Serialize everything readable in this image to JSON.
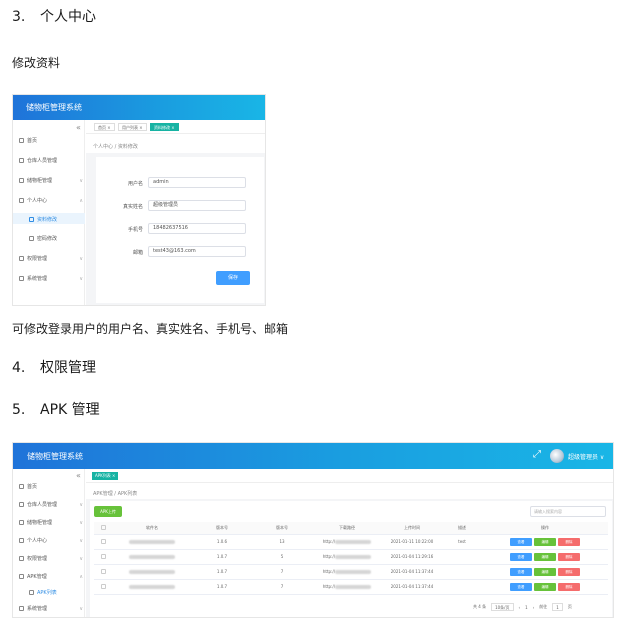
{
  "doc": {
    "section3": {
      "num": "3.",
      "title": "个人中心"
    },
    "subheading": "修改资料",
    "description": "可修改登录用户的用户名、真实姓名、手机号、邮箱",
    "section4": {
      "num": "4.",
      "title": "权限管理"
    },
    "section5": {
      "num": "5.",
      "title": "APK 管理"
    }
  },
  "shot1": {
    "app_title": "储物柜管理系统",
    "collapse_icon": "«",
    "nav": [
      {
        "label": "首页",
        "icon": "home-icon"
      },
      {
        "label": "仓库人员管理",
        "icon": "users-icon",
        "arrow": "∨"
      },
      {
        "label": "储物柜管理",
        "icon": "cabinet-icon",
        "arrow": "∨"
      },
      {
        "label": "个人中心",
        "icon": "user-icon",
        "arrow": "∧"
      },
      {
        "label": "资料修改",
        "icon": "doc-icon"
      },
      {
        "label": "密码修改",
        "icon": "key-icon"
      },
      {
        "label": "权限管理",
        "icon": "shield-icon",
        "arrow": "∨"
      },
      {
        "label": "系统管理",
        "icon": "gear-icon",
        "arrow": "∨"
      }
    ],
    "tabs": [
      {
        "label": "首页 ×"
      },
      {
        "label": "用户列表 ×"
      },
      {
        "label": "资料修改 ×"
      }
    ],
    "breadcrumb": "个人中心 / 资料修改",
    "form": {
      "username_label": "用户名",
      "username_value": "admin",
      "realname_label": "真实姓名",
      "realname_value": "超级管理员",
      "phone_label": "手机号",
      "phone_value": "18482637516",
      "email_label": "邮箱",
      "email_value": "test43@163.com",
      "save_label": "保存"
    }
  },
  "shot2": {
    "app_title": "储物柜管理系统",
    "fullscreen_icon": "⤢",
    "user_name": "超级管理员 ∨",
    "collapse_icon": "«",
    "nav": [
      {
        "label": "首页",
        "icon": "home-icon"
      },
      {
        "label": "仓库人员管理",
        "icon": "users-icon",
        "arrow": "∨"
      },
      {
        "label": "储物柜管理",
        "icon": "cabinet-icon",
        "arrow": "∨"
      },
      {
        "label": "个人中心",
        "icon": "user-icon",
        "arrow": "∨"
      },
      {
        "label": "权限管理",
        "icon": "shield-icon",
        "arrow": "∨"
      },
      {
        "label": "APK管理",
        "icon": "apk-icon",
        "arrow": "∧"
      },
      {
        "label": "APK列表",
        "icon": "list-icon"
      },
      {
        "label": "系统管理",
        "icon": "gear-icon",
        "arrow": "∨"
      }
    ],
    "tab_label": "APK列表 ×",
    "breadcrumb": "APK管理 / APK列表",
    "upload_label": "APK上传",
    "search_placeholder": "请输入搜索内容",
    "columns": [
      "",
      "软件名",
      "版本号",
      "版本号",
      "下载路径",
      "上传时间",
      "描述",
      "操作"
    ],
    "rows": [
      {
        "version": "1.0.6",
        "code": "13",
        "path": "http://",
        "time": "2021-01-11 10:22:00",
        "desc": "test"
      },
      {
        "version": "1.0.7",
        "code": "5",
        "path": "http://",
        "time": "2021-01-04 11:29:16",
        "desc": ""
      },
      {
        "version": "1.0.7",
        "code": "7",
        "path": "http://",
        "time": "2021-01-04 11:37:44",
        "desc": ""
      },
      {
        "version": "1.0.7",
        "code": "7",
        "path": "http://",
        "time": "2021-01-04 11:37:44",
        "desc": ""
      }
    ],
    "actions": {
      "view": "查看",
      "edit": "编辑",
      "delete": "删除"
    },
    "pager": {
      "total": "共 4 条",
      "size": "10条/页",
      "prev": "‹",
      "page": "1",
      "next": "›",
      "goto": "前往",
      "goto_page": "1",
      "goto_suffix": "页"
    }
  },
  "colors": {
    "header_start": "#1f73d9",
    "header_end": "#19b6e6",
    "primary": "#409eff",
    "success": "#67c23a",
    "danger": "#f56c6c",
    "tab_active": "#17b3a3"
  }
}
